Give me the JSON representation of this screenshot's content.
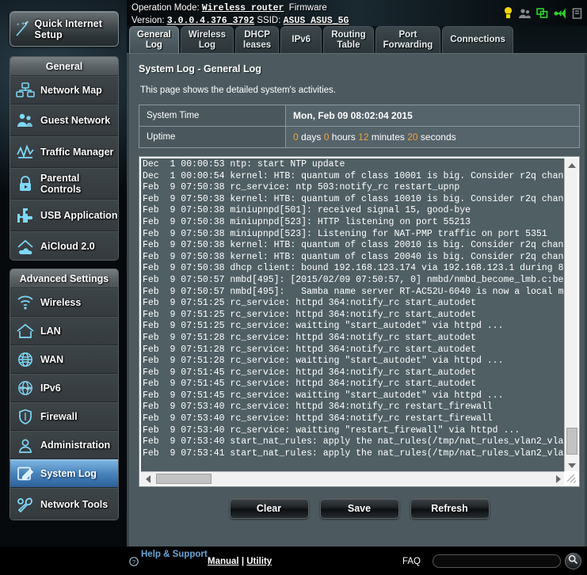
{
  "sidebar": {
    "quick_setup": {
      "label": "Quick Internet Setup",
      "icon": "magic-wand-icon"
    },
    "general_header": "General",
    "general_items": [
      {
        "label": "Network Map",
        "icon": "network-map-icon"
      },
      {
        "label": "Guest Network",
        "icon": "guest-network-icon"
      },
      {
        "label": "Traffic Manager",
        "icon": "traffic-manager-icon"
      },
      {
        "label": "Parental Controls",
        "icon": "lock-icon"
      },
      {
        "label": "USB Application",
        "icon": "puzzle-icon"
      },
      {
        "label": "AiCloud 2.0",
        "icon": "cloud-icon"
      }
    ],
    "advanced_header": "Advanced Settings",
    "advanced_items": [
      {
        "label": "Wireless",
        "icon": "wifi-icon",
        "active": false
      },
      {
        "label": "LAN",
        "icon": "home-icon",
        "active": false
      },
      {
        "label": "WAN",
        "icon": "globe-icon",
        "active": false
      },
      {
        "label": "IPv6",
        "icon": "ipv6-globe-icon",
        "active": false
      },
      {
        "label": "Firewall",
        "icon": "shield-icon",
        "active": false
      },
      {
        "label": "Administration",
        "icon": "user-icon",
        "active": false
      },
      {
        "label": "System Log",
        "icon": "log-pencil-icon",
        "active": true
      },
      {
        "label": "Network Tools",
        "icon": "wrench-icon",
        "active": false
      }
    ]
  },
  "topbar": {
    "operation_mode_label": "Operation Mode:",
    "operation_mode_value": "Wireless router",
    "firmware_label": "Firmware Version:",
    "firmware_value": "3.0.0.4.376_3792",
    "ssid_label": "SSID:",
    "ssid_value": "ASUS  ASUS_5G",
    "status_icons": [
      {
        "name": "notification-icon",
        "color": "#f5d800"
      },
      {
        "name": "guest-users-icon",
        "color": "#8a8a8a"
      },
      {
        "name": "connected-clients-icon",
        "color": "#2fd12f"
      },
      {
        "name": "usb-device-icon",
        "color": "#2fd12f"
      },
      {
        "name": "printer-icon",
        "color": "#8a8a8a"
      }
    ]
  },
  "tabs": [
    {
      "label": "General\nLog",
      "active": true
    },
    {
      "label": "Wireless\nLog",
      "active": false
    },
    {
      "label": "DHCP\nleases",
      "active": false
    },
    {
      "label": "IPv6",
      "active": false
    },
    {
      "label": "Routing\nTable",
      "active": false
    },
    {
      "label": "Port\nForwarding",
      "active": false
    },
    {
      "label": "Connections",
      "active": false
    }
  ],
  "content": {
    "title": "System Log - General Log",
    "description": "This page shows the detailed system's activities.",
    "system_time_label": "System Time",
    "system_time_value": "Mon, Feb 09  08:02:04  2015",
    "uptime_label": "Uptime",
    "uptime": {
      "days": "0",
      "days_unit": "days",
      "hours": "0",
      "hours_unit": "hours",
      "minutes": "12",
      "minutes_unit": "minutes",
      "seconds": "20",
      "seconds_unit": "seconds"
    },
    "accent_number_color": "#f0a33c",
    "log_lines": [
      "Dec  1 00:00:53 ntp: start NTP update",
      "Dec  1 00:00:54 kernel: HTB: quantum of class 10001 is big. Consider r2q chan",
      "Feb  9 07:50:38 rc_service: ntp 503:notify_rc restart_upnp",
      "Feb  9 07:50:38 kernel: HTB: quantum of class 10010 is big. Consider r2q chan",
      "Feb  9 07:50:38 miniupnpd[501]: received signal 15, good-bye",
      "Feb  9 07:50:38 miniupnpd[523]: HTTP listening on port 55213",
      "Feb  9 07:50:38 miniupnpd[523]: Listening for NAT-PMP traffic on port 5351",
      "Feb  9 07:50:38 kernel: HTB: quantum of class 20010 is big. Consider r2q chan",
      "Feb  9 07:50:38 kernel: HTB: quantum of class 20040 is big. Consider r2q chan",
      "Feb  9 07:50:38 dhcp client: bound 192.168.123.174 via 192.168.123.1 during 8",
      "Feb  9 07:50:57 nmbd[495]: [2015/02/09 07:50:57, 0] nmbd/nmbd_become_lmb.c:be",
      "Feb  9 07:50:57 nmbd[495]:   Samba name server RT-AC52U-6040 is now a local m",
      "Feb  9 07:51:25 rc_service: httpd 364:notify_rc start_autodet",
      "Feb  9 07:51:25 rc_service: httpd 364:notify_rc start_autodet",
      "Feb  9 07:51:25 rc_service: waitting \"start_autodet\" via httpd ...",
      "Feb  9 07:51:28 rc_service: httpd 364:notify_rc start_autodet",
      "Feb  9 07:51:28 rc_service: httpd 364:notify_rc start_autodet",
      "Feb  9 07:51:28 rc_service: waitting \"start_autodet\" via httpd ...",
      "Feb  9 07:51:45 rc_service: httpd 364:notify_rc start_autodet",
      "Feb  9 07:51:45 rc_service: httpd 364:notify_rc start_autodet",
      "Feb  9 07:51:45 rc_service: waitting \"start_autodet\" via httpd ...",
      "Feb  9 07:53:40 rc_service: httpd 364:notify_rc restart_firewall",
      "Feb  9 07:53:40 rc_service: httpd 364:notify_rc restart_firewall",
      "Feb  9 07:53:40 rc_service: waitting \"restart_firewall\" via httpd ...",
      "Feb  9 07:53:40 start_nat_rules: apply the nat_rules(/tmp/nat_rules_vlan2_vla",
      "Feb  9 07:53:41 start_nat_rules: apply the nat_rules(/tmp/nat_rules_vlan2_vla"
    ],
    "buttons": [
      {
        "label": "Clear",
        "name": "clear-button"
      },
      {
        "label": "Save",
        "name": "save-button"
      },
      {
        "label": "Refresh",
        "name": "refresh-button"
      }
    ]
  },
  "footer": {
    "help_support": "Help & Support",
    "manual": "Manual",
    "separator": "|",
    "utility": "Utility",
    "faq_label": "FAQ",
    "faq_value": "",
    "faq_placeholder": ""
  }
}
